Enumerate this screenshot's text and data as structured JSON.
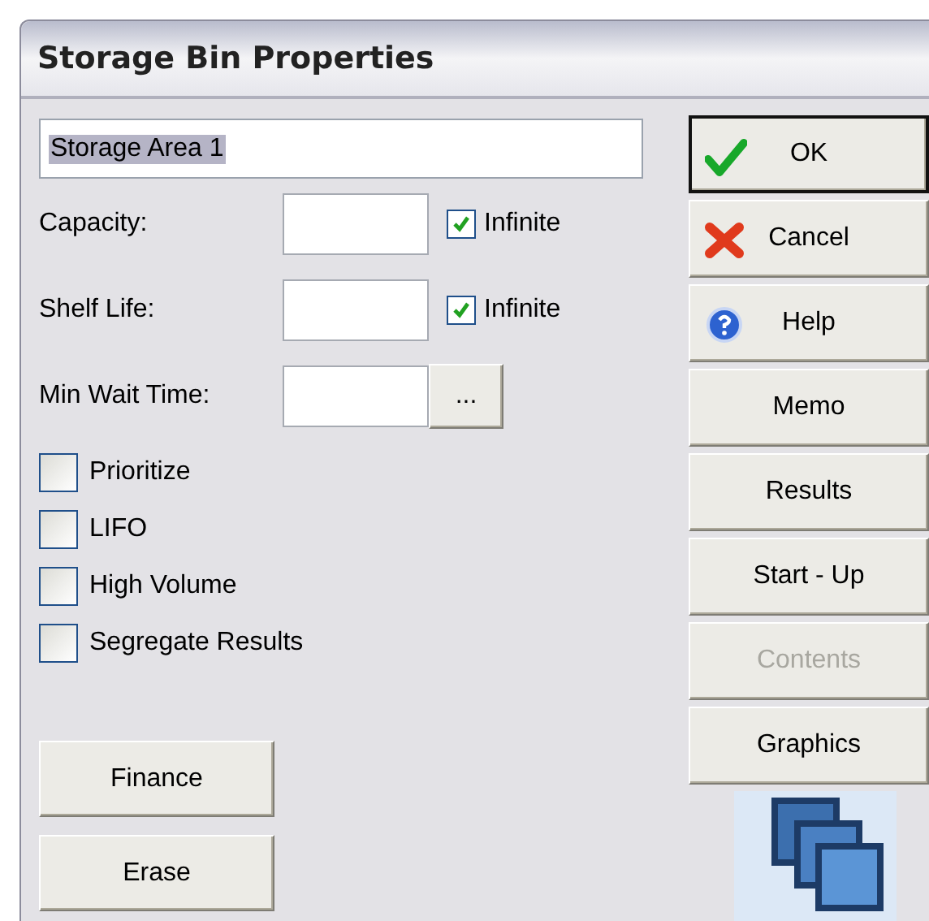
{
  "window": {
    "title": "Storage Bin Properties"
  },
  "name_field": {
    "value": "Storage Area 1"
  },
  "fields": [
    {
      "label": "Capacity:",
      "kind": "infinite",
      "checkbox": {
        "label": "Infinite",
        "checked": true
      }
    },
    {
      "label": "Shelf Life:",
      "kind": "infinite",
      "checkbox": {
        "label": "Infinite",
        "checked": true
      }
    },
    {
      "label": "Min Wait Time:",
      "kind": "browse",
      "button": "..."
    }
  ],
  "options": [
    {
      "label": "Prioritize",
      "checked": false
    },
    {
      "label": "LIFO",
      "checked": false
    },
    {
      "label": "High Volume",
      "checked": false
    },
    {
      "label": "Segregate Results",
      "checked": false
    }
  ],
  "left_buttons": [
    "Finance",
    "Erase"
  ],
  "right_buttons": [
    {
      "label": "OK",
      "kind": "ok",
      "default": true,
      "disabled": false
    },
    {
      "label": "Cancel",
      "kind": "cancel",
      "default": false,
      "disabled": false
    },
    {
      "label": "Help",
      "kind": "help",
      "default": false,
      "disabled": false
    },
    {
      "label": "Memo",
      "kind": "plain",
      "default": false,
      "disabled": false
    },
    {
      "label": "Results",
      "kind": "plain",
      "default": false,
      "disabled": false
    },
    {
      "label": "Start - Up",
      "kind": "plain",
      "default": false,
      "disabled": false
    },
    {
      "label": "Contents",
      "kind": "plain",
      "default": false,
      "disabled": true
    },
    {
      "label": "Graphics",
      "kind": "plain",
      "default": false,
      "disabled": false
    }
  ]
}
